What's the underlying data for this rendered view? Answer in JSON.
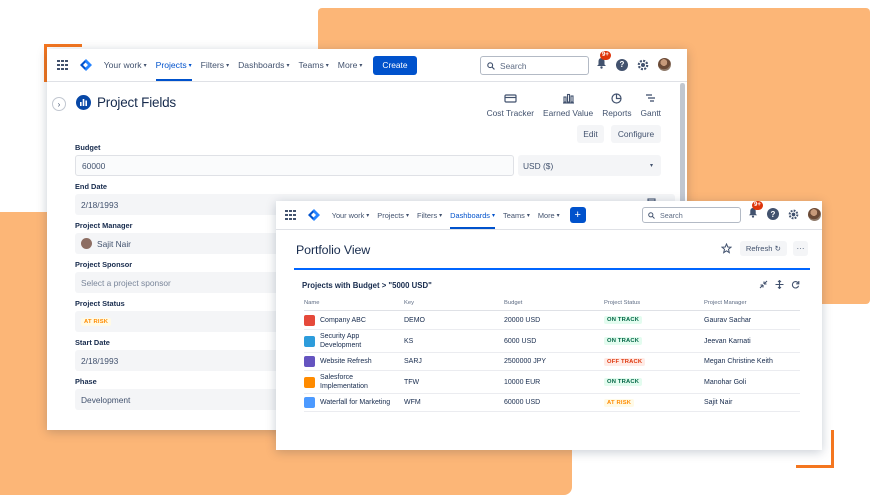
{
  "colors": {
    "brand": "#0052cc",
    "orange_bg": "#fcb677",
    "orange_bracket": "#f4761f"
  },
  "window1": {
    "nav": {
      "items": [
        {
          "label": "Your work",
          "active": false
        },
        {
          "label": "Projects",
          "active": true
        },
        {
          "label": "Filters",
          "active": false
        },
        {
          "label": "Dashboards",
          "active": false
        },
        {
          "label": "Teams",
          "active": false
        },
        {
          "label": "More",
          "active": false
        }
      ],
      "create_label": "Create",
      "search_placeholder": "Search",
      "notification_badge": "9+"
    },
    "page_title": "Project Fields",
    "toolbar": [
      {
        "label": "Cost Tracker",
        "icon": "money-icon"
      },
      {
        "label": "Earned Value",
        "icon": "bar-chart-icon"
      },
      {
        "label": "Reports",
        "icon": "pie-chart-icon"
      },
      {
        "label": "Gantt",
        "icon": "gantt-icon"
      }
    ],
    "edit_label": "Edit",
    "configure_label": "Configure",
    "fields": {
      "budget": {
        "label": "Budget",
        "value": "60000",
        "currency": "USD ($)"
      },
      "end_date": {
        "label": "End Date",
        "value": "2/18/1993"
      },
      "project_manager": {
        "label": "Project Manager",
        "value": "Sajit Nair"
      },
      "project_sponsor": {
        "label": "Project Sponsor",
        "placeholder": "Select a project sponsor"
      },
      "project_status": {
        "label": "Project Status",
        "value": "AT RISK"
      },
      "start_date": {
        "label": "Start Date",
        "value": "2/18/1993"
      },
      "phase": {
        "label": "Phase",
        "value": "Development"
      }
    }
  },
  "window2": {
    "nav": {
      "items": [
        {
          "label": "Your work",
          "active": false
        },
        {
          "label": "Projects",
          "active": false
        },
        {
          "label": "Filters",
          "active": false
        },
        {
          "label": "Dashboards",
          "active": true
        },
        {
          "label": "Teams",
          "active": false
        },
        {
          "label": "More",
          "active": false
        }
      ],
      "create_label": "+",
      "search_placeholder": "Search",
      "notification_badge": "9+"
    },
    "page_title": "Portfolio View",
    "refresh_label": "Refresh",
    "more_label": "···",
    "gadget": {
      "title": "Projects with Budget > \"5000 USD\"",
      "columns": [
        "Name",
        "Key",
        "Budget",
        "Project Status",
        "Project Manager"
      ],
      "rows": [
        {
          "name": "Company ABC",
          "key": "DEMO",
          "budget": "20000 USD",
          "status": "ON TRACK",
          "status_type": "track",
          "manager": "Gaurav Sachar",
          "icon_color": "#e5493a"
        },
        {
          "name": "Security App Development",
          "key": "KS",
          "budget": "6000 USD",
          "status": "ON TRACK",
          "status_type": "track",
          "manager": "Jeevan Karnati",
          "icon_color": "#2d9cdb"
        },
        {
          "name": "Website Refresh",
          "key": "SARJ",
          "budget": "2500000 JPY",
          "status": "OFF TRACK",
          "status_type": "off",
          "manager": "Megan Christine Keith",
          "icon_color": "#6554c0"
        },
        {
          "name": "Salesforce Implementation",
          "key": "TFW",
          "budget": "10000 EUR",
          "status": "ON TRACK",
          "status_type": "track",
          "manager": "Manohar Goli",
          "icon_color": "#ff8b00"
        },
        {
          "name": "Waterfall for Marketing",
          "key": "WFM",
          "budget": "60000 USD",
          "status": "AT RISK",
          "status_type": "risk",
          "manager": "Sajit Nair",
          "icon_color": "#4c9aff"
        }
      ]
    }
  }
}
